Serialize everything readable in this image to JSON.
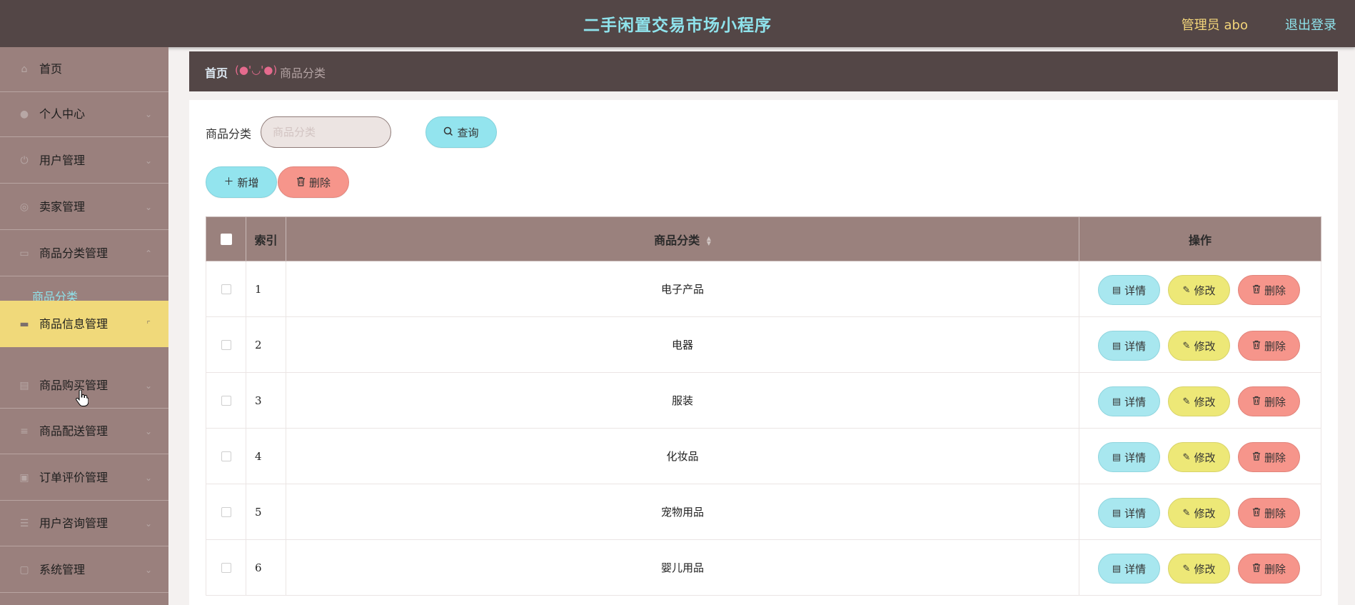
{
  "header": {
    "title": "二手闲置交易市场小程序",
    "user": "管理员 abo",
    "logout": "退出登录"
  },
  "sidebar": {
    "items": [
      {
        "label": "首页",
        "icon": "home-icon"
      },
      {
        "label": "个人中心",
        "icon": "user-icon"
      },
      {
        "label": "用户管理",
        "icon": "power-icon"
      },
      {
        "label": "卖家管理",
        "icon": "globe-icon"
      },
      {
        "label": "商品分类管理",
        "icon": "bank-icon"
      },
      {
        "label": "商品信息管理",
        "icon": "monitor-icon"
      },
      {
        "label": "商品购买管理",
        "icon": "cart-icon"
      },
      {
        "label": "商品配送管理",
        "icon": "menu-icon"
      },
      {
        "label": "订单评价管理",
        "icon": "clipboard-icon"
      },
      {
        "label": "用户咨询管理",
        "icon": "list-icon"
      },
      {
        "label": "系统管理",
        "icon": "square-icon"
      }
    ],
    "submenu_label": "商品分类"
  },
  "breadcrumb": {
    "home": "首页",
    "separator": "(●'◡'●)",
    "current": "商品分类"
  },
  "search": {
    "label": "商品分类",
    "placeholder": "商品分类",
    "button": "查询"
  },
  "actions": {
    "add": "新增",
    "delete": "删除"
  },
  "table": {
    "headers": {
      "index": "索引",
      "category": "商品分类",
      "ops": "操作"
    },
    "rows": [
      {
        "index": "1",
        "category": "电子产品"
      },
      {
        "index": "2",
        "category": "电器"
      },
      {
        "index": "3",
        "category": "服装"
      },
      {
        "index": "4",
        "category": "化妆品"
      },
      {
        "index": "5",
        "category": "宠物用品"
      },
      {
        "index": "6",
        "category": "婴儿用品"
      }
    ],
    "op_labels": {
      "detail": "详情",
      "edit": "修改",
      "delete": "删除"
    }
  },
  "colors": {
    "header_bg": "#534646",
    "sidebar_bg": "#9a807d",
    "active_menu": "#f0d97a",
    "accent_cyan": "#93e4ee",
    "edit_yellow": "#ede877",
    "danger_red": "#f6958b"
  }
}
